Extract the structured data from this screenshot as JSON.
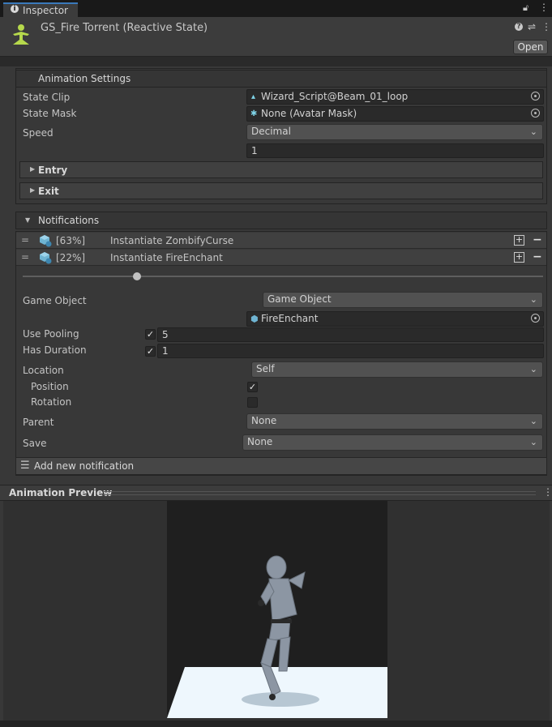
{
  "tab": {
    "label": "Inspector"
  },
  "header": {
    "title": "GS_Fire Torrent (Reactive State)",
    "open_label": "Open"
  },
  "animation_settings": {
    "title": "Animation Settings",
    "state_clip": {
      "label": "State Clip",
      "value": "Wizard_Script@Beam_01_loop"
    },
    "state_mask": {
      "label": "State Mask",
      "value": "None (Avatar Mask)"
    },
    "speed": {
      "label": "Speed",
      "mode": "Decimal",
      "value": "1"
    },
    "entry": "Entry",
    "exit": "Exit"
  },
  "notifications": {
    "title": "Notifications",
    "items": [
      {
        "percent": "[63%]",
        "name": "Instantiate ZombifyCurse"
      },
      {
        "percent": "[22%]",
        "name": "Instantiate FireEnchant"
      }
    ],
    "slider_value": 0.22,
    "game_object": {
      "label": "Game Object",
      "mode": "Game Object",
      "value": "FireEnchant"
    },
    "use_pooling": {
      "label": "Use Pooling",
      "checked": true,
      "value": "5"
    },
    "has_duration": {
      "label": "Has Duration",
      "checked": true,
      "value": "1"
    },
    "location": {
      "label": "Location",
      "value": "Self"
    },
    "position": {
      "label": "Position",
      "checked": true
    },
    "rotation": {
      "label": "Rotation",
      "checked": false
    },
    "parent": {
      "label": "Parent",
      "value": "None"
    },
    "save": {
      "label": "Save",
      "value": "None"
    },
    "add_label": "Add new notification"
  },
  "preview": {
    "title": "Animation Preview"
  },
  "colors": {
    "accent": "#3a79bb",
    "icon_green": "#b6d94c",
    "panel": "#383838"
  }
}
